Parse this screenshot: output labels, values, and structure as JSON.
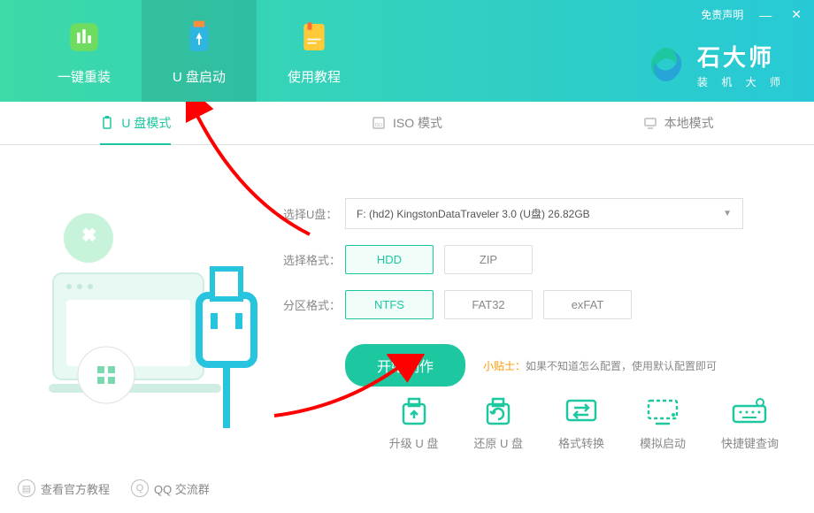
{
  "titlebar": {
    "disclaimer": "免责声明"
  },
  "brand": {
    "title": "石大师",
    "subtitle": "装 机 大 师"
  },
  "nav": {
    "reinstall": "一键重装",
    "usb": "U 盘启动",
    "tutorial": "使用教程"
  },
  "modes": {
    "usb": "U 盘模式",
    "iso": "ISO 模式",
    "local": "本地模式"
  },
  "form": {
    "usb_label": "选择U盘：",
    "usb_value": "F: (hd2) KingstonDataTraveler 3.0 (U盘) 26.82GB",
    "disk_fmt_label": "选择格式：",
    "disk_opts": [
      "HDD",
      "ZIP"
    ],
    "part_fmt_label": "分区格式：",
    "part_opts": [
      "NTFS",
      "FAT32",
      "exFAT"
    ],
    "start_btn": "开始制作",
    "tip_label": "小贴士：",
    "tip_text": "如果不知道怎么配置，使用默认配置即可"
  },
  "footer_actions": {
    "upgrade": "升级 U 盘",
    "restore": "还原 U 盘",
    "convert": "格式转换",
    "simulate": "模拟启动",
    "shortcut": "快捷键查询"
  },
  "bottom_links": {
    "tutorial": "查看官方教程",
    "qq": "QQ 交流群"
  }
}
